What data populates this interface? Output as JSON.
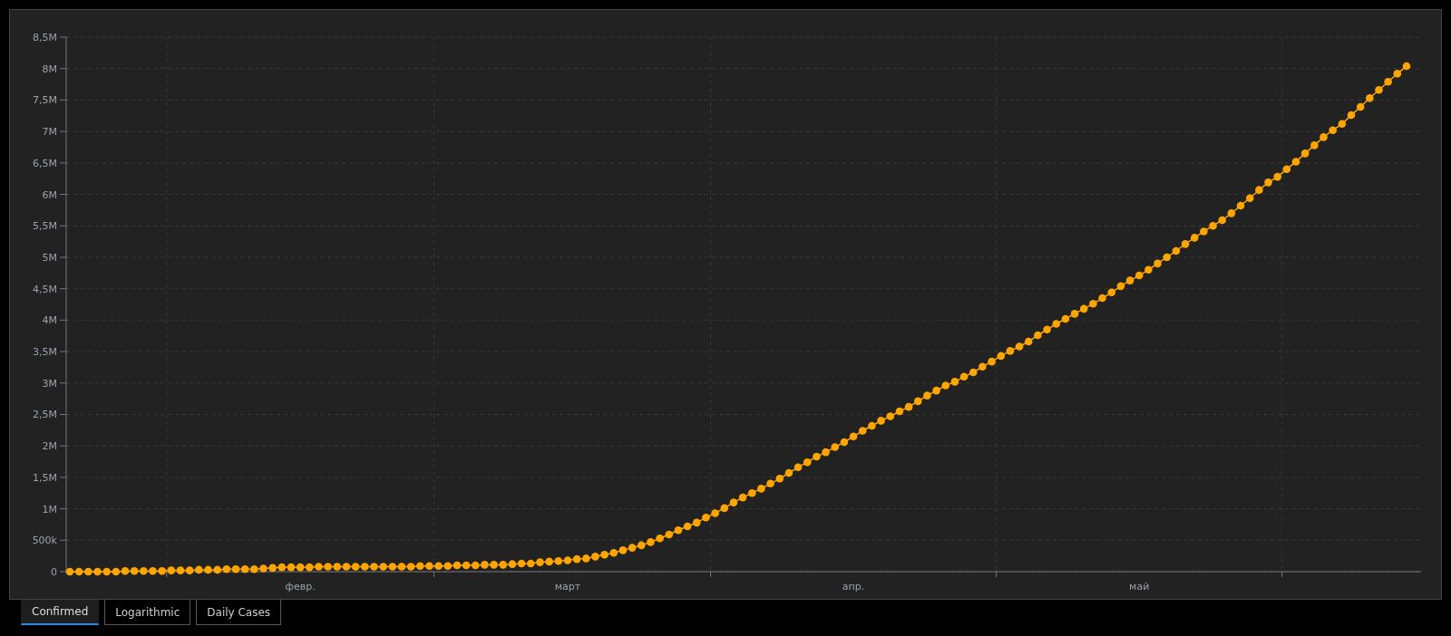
{
  "chart": {
    "chart_data": {
      "type": "line",
      "categories": [
        null,
        null,
        null,
        null,
        null,
        null,
        null,
        null,
        null,
        null,
        null,
        null,
        null,
        null,
        null,
        null,
        null,
        null,
        null,
        null,
        null,
        null,
        null,
        null,
        null,
        "февр.",
        null,
        null,
        null,
        null,
        null,
        null,
        null,
        null,
        null,
        null,
        null,
        null,
        null,
        null,
        null,
        null,
        null,
        null,
        null,
        null,
        null,
        null,
        null,
        null,
        null,
        null,
        null,
        null,
        "март",
        null,
        null,
        null,
        null,
        null,
        null,
        null,
        null,
        null,
        null,
        null,
        null,
        null,
        null,
        null,
        null,
        null,
        null,
        null,
        null,
        null,
        null,
        null,
        null,
        null,
        null,
        null,
        null,
        null,
        null,
        "апр.",
        null,
        null,
        null,
        null,
        null,
        null,
        null,
        null,
        null,
        null,
        null,
        null,
        null,
        null,
        null,
        null,
        null,
        null,
        null,
        null,
        null,
        null,
        null,
        null,
        null,
        null,
        null,
        null,
        null,
        null,
        "май",
        null,
        null,
        null,
        null,
        null,
        null,
        null,
        null,
        null,
        null,
        null,
        null,
        null,
        null,
        null,
        null,
        null,
        null,
        null,
        null,
        null,
        null,
        null,
        null,
        null,
        null,
        null,
        null,
        null
      ],
      "grid": true,
      "series": [
        {
          "color": "#ffa500",
          "marker": true,
          "values": [
            0,
            0,
            0,
            0,
            0,
            0,
            10000,
            10000,
            10000,
            10000,
            10000,
            20000,
            20000,
            20000,
            30000,
            30000,
            30000,
            40000,
            40000,
            40000,
            40000,
            50000,
            60000,
            70000,
            70000,
            70000,
            70000,
            80000,
            80000,
            80000,
            80000,
            80000,
            80000,
            80000,
            80000,
            80000,
            80000,
            80000,
            90000,
            90000,
            90000,
            90000,
            100000,
            100000,
            100000,
            110000,
            110000,
            110000,
            120000,
            130000,
            130000,
            150000,
            160000,
            170000,
            180000,
            200000,
            210000,
            240000,
            270000,
            300000,
            340000,
            380000,
            420000,
            470000,
            530000,
            590000,
            660000,
            720000,
            780000,
            860000,
            930000,
            1010000,
            1100000,
            1180000,
            1250000,
            1320000,
            1400000,
            1480000,
            1570000,
            1660000,
            1740000,
            1830000,
            1900000,
            1980000,
            2060000,
            2150000,
            2240000,
            2320000,
            2400000,
            2470000,
            2550000,
            2620000,
            2710000,
            2800000,
            2880000,
            2960000,
            3020000,
            3100000,
            3170000,
            3260000,
            3340000,
            3430000,
            3510000,
            3580000,
            3660000,
            3760000,
            3850000,
            3940000,
            4020000,
            4100000,
            4180000,
            4260000,
            4350000,
            4440000,
            4540000,
            4630000,
            4710000,
            4800000,
            4900000,
            5000000,
            5100000,
            5210000,
            5310000,
            5410000,
            5500000,
            5590000,
            5700000,
            5820000,
            5940000,
            6070000,
            6190000,
            6280000,
            6400000,
            6520000,
            6650000,
            6780000,
            6910000,
            7020000,
            7120000,
            7260000,
            7390000,
            7530000,
            7660000,
            7790000,
            7920000,
            8040000
          ]
        }
      ],
      "ylim": [
        0,
        8500000
      ],
      "yticks": [
        {
          "value": 0,
          "label": "0"
        },
        {
          "value": 500000,
          "label": "500k"
        },
        {
          "value": 1000000,
          "label": "1M"
        },
        {
          "value": 1500000,
          "label": "1,5M"
        },
        {
          "value": 2000000,
          "label": "2M"
        },
        {
          "value": 2500000,
          "label": "2,5M"
        },
        {
          "value": 3000000,
          "label": "3M"
        },
        {
          "value": 3500000,
          "label": "3,5M"
        },
        {
          "value": 4000000,
          "label": "4M"
        },
        {
          "value": 4500000,
          "label": "4,5M"
        },
        {
          "value": 5000000,
          "label": "5M"
        },
        {
          "value": 5500000,
          "label": "5,5M"
        },
        {
          "value": 6000000,
          "label": "6M"
        },
        {
          "value": 6500000,
          "label": "6,5M"
        },
        {
          "value": 7000000,
          "label": "7M"
        },
        {
          "value": 7500000,
          "label": "7,5M"
        },
        {
          "value": 8000000,
          "label": "8M"
        },
        {
          "value": 8500000,
          "label": "8,5M"
        }
      ]
    }
  },
  "tabs": [
    {
      "label": "Confirmed",
      "selected": true
    },
    {
      "label": "Logarithmic",
      "selected": false
    },
    {
      "label": "Daily Cases",
      "selected": false
    }
  ]
}
